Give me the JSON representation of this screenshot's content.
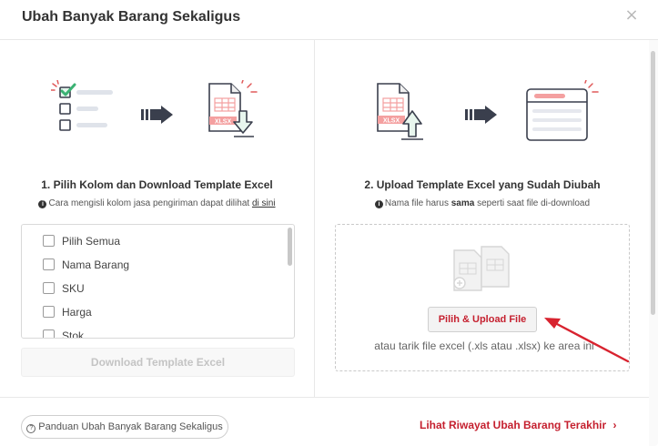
{
  "modal": {
    "title": "Ubah Banyak Barang Sekaligus",
    "close_glyph": "×"
  },
  "step1": {
    "title": "1. Pilih Kolom dan Download Template Excel",
    "hint_text": "Cara mengisli kolom jasa pengiriman dapat dilihat ",
    "hint_link": "di sini",
    "items": [
      {
        "label": "Pilih Semua",
        "checked": false
      },
      {
        "label": "Nama Barang",
        "checked": false
      },
      {
        "label": "SKU",
        "checked": false
      },
      {
        "label": "Harga",
        "checked": false
      },
      {
        "label": "Stok",
        "checked": false
      }
    ],
    "download_label": "Download Template Excel"
  },
  "step2": {
    "title": "2. Upload Template Excel yang Sudah Diubah",
    "hint_pre": "Nama file harus ",
    "hint_bold": "sama",
    "hint_post": " seperti saat file di-download",
    "upload_label": "Pilih & Upload File",
    "drop_hint": "atau tarik file excel (.xls atau .xlsx) ke area ini"
  },
  "illustration": {
    "file_badge": "XLSX"
  },
  "footer": {
    "guide_label": "Panduan Ubah Banyak Barang Sekaligus",
    "guide_icon": "?",
    "history_label": "Lihat Riwayat Ubah Barang Terakhir",
    "history_chevron": "›"
  },
  "colors": {
    "accent": "#c5202f",
    "annotation_arrow": "#d8232f",
    "checkmark": "#3bb273",
    "illustration_red": "#e05a5a",
    "illustration_pink": "#f4a0a0",
    "illustration_gray": "#3a3f4d"
  }
}
